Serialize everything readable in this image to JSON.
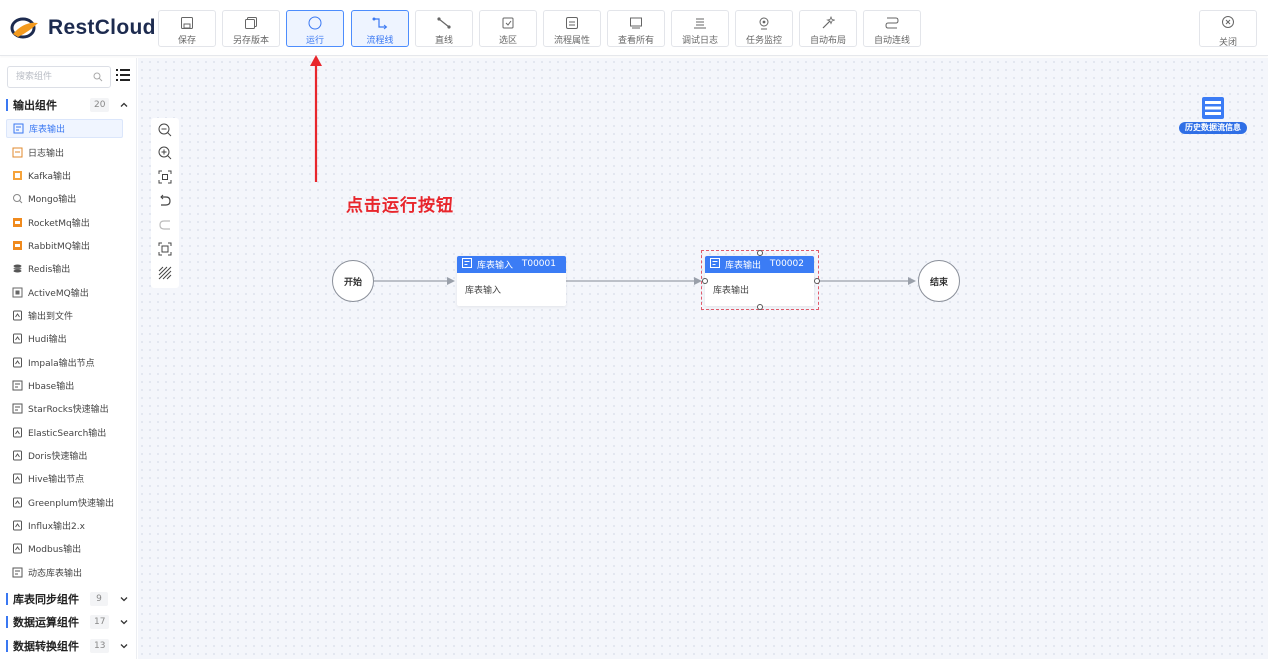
{
  "app": {
    "logo_text": "RestCloud"
  },
  "toolbar": {
    "save": "保存",
    "save_as": "另存版本",
    "run": "运行",
    "flow_line": "流程线",
    "straight": "直线",
    "select_area": "选区",
    "flow_props": "流程属性",
    "view_all": "查看所有",
    "debug_log": "调试日志",
    "task_monitor": "任务监控",
    "auto_layout": "自动布局",
    "auto_connect": "自动连线",
    "close": "关闭"
  },
  "sidebar": {
    "search_placeholder": "搜索组件",
    "groups": [
      {
        "name": "输出组件",
        "count": "20",
        "expanded": true
      },
      {
        "name": "库表同步组件",
        "count": "9",
        "expanded": false
      },
      {
        "name": "数据运算组件",
        "count": "17",
        "expanded": false
      },
      {
        "name": "数据转换组件",
        "count": "13",
        "expanded": false
      }
    ],
    "items": [
      {
        "label": "库表输出",
        "icon": "table-output-icon",
        "selected": true
      },
      {
        "label": "日志输出",
        "icon": "log-icon"
      },
      {
        "label": "Kafka输出",
        "icon": "kafka-icon"
      },
      {
        "label": "Mongo输出",
        "icon": "mongo-icon"
      },
      {
        "label": "RocketMq输出",
        "icon": "rocketmq-icon"
      },
      {
        "label": "RabbitMQ输出",
        "icon": "rabbitmq-icon"
      },
      {
        "label": "Redis输出",
        "icon": "redis-icon"
      },
      {
        "label": "ActiveMQ输出",
        "icon": "activemq-icon"
      },
      {
        "label": "输出到文件",
        "icon": "file-icon"
      },
      {
        "label": "Hudi输出",
        "icon": "file-icon"
      },
      {
        "label": "Impala输出节点",
        "icon": "file-icon"
      },
      {
        "label": "Hbase输出",
        "icon": "table-output-icon"
      },
      {
        "label": "StarRocks快速输出",
        "icon": "table-output-icon"
      },
      {
        "label": "ElasticSearch输出",
        "icon": "file-icon"
      },
      {
        "label": "Doris快速输出",
        "icon": "file-icon"
      },
      {
        "label": "Hive输出节点",
        "icon": "file-icon"
      },
      {
        "label": "Greenplum快速输出",
        "icon": "file-icon"
      },
      {
        "label": "Influx输出2.x",
        "icon": "file-icon"
      },
      {
        "label": "Modbus输出",
        "icon": "file-icon"
      },
      {
        "label": "动态库表输出",
        "icon": "table-output-icon"
      }
    ]
  },
  "flow": {
    "start_label": "开始",
    "end_label": "结束",
    "nodes": [
      {
        "title": "库表输入",
        "code": "T00001",
        "body": "库表输入"
      },
      {
        "title": "库表输出",
        "code": "T00002",
        "body": "库表输出",
        "selected": true
      }
    ]
  },
  "annotation": {
    "text": "点击运行按钮",
    "color": "#e8262c"
  },
  "history_button": {
    "label": "历史数据流信息"
  },
  "colors": {
    "accent": "#3b7cf5",
    "selection": "#e05a6b"
  }
}
